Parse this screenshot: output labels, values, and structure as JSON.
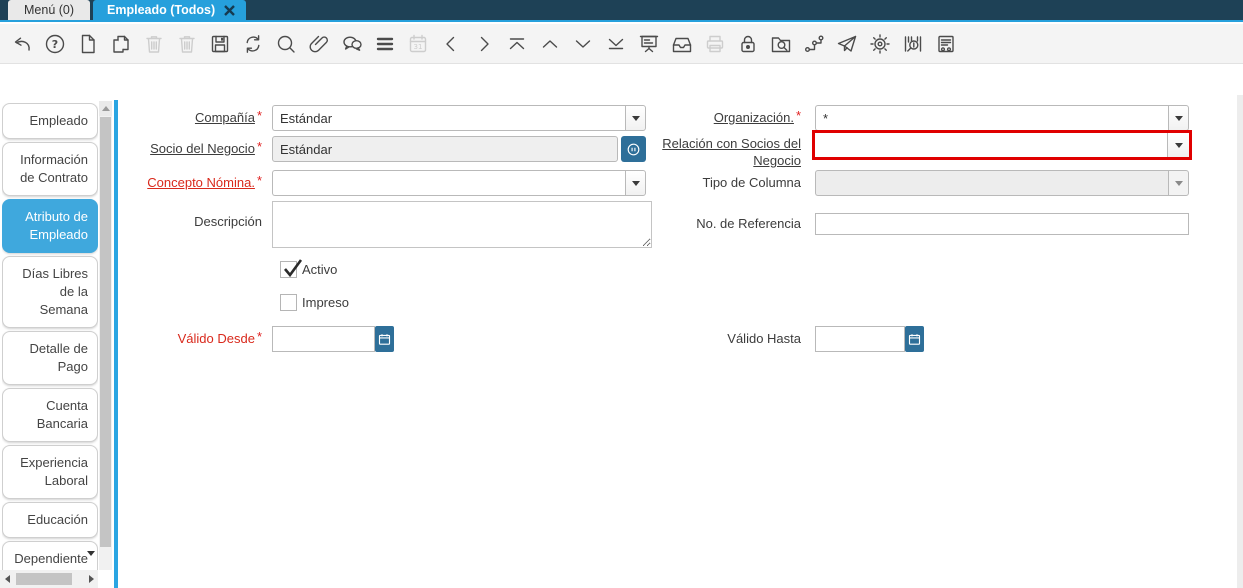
{
  "tabbar": {
    "tabs": [
      {
        "id": "menu",
        "label": "Menú (0)",
        "selected": false,
        "closable": false
      },
      {
        "id": "empleado-todos",
        "label": "Empleado (Todos)",
        "selected": true,
        "closable": true
      }
    ]
  },
  "toolbar": {
    "items": [
      {
        "name": "undo",
        "enabled": true
      },
      {
        "name": "help",
        "enabled": true
      },
      {
        "name": "new-record",
        "enabled": true
      },
      {
        "name": "copy-record",
        "enabled": true
      },
      {
        "name": "delete-record",
        "enabled": false
      },
      {
        "name": "delete-selection",
        "enabled": false
      },
      {
        "name": "save",
        "enabled": true
      },
      {
        "name": "refresh",
        "enabled": true
      },
      {
        "name": "find",
        "enabled": true
      },
      {
        "name": "attachment",
        "enabled": true
      },
      {
        "name": "chat",
        "enabled": true
      },
      {
        "name": "grid-toggle",
        "enabled": true
      },
      {
        "name": "calendar",
        "enabled": false
      },
      {
        "name": "parent-record",
        "enabled": true
      },
      {
        "name": "detail-record",
        "enabled": true
      },
      {
        "name": "first-record",
        "enabled": true
      },
      {
        "name": "previous-record",
        "enabled": true
      },
      {
        "name": "next-record",
        "enabled": true
      },
      {
        "name": "last-record",
        "enabled": true
      },
      {
        "name": "report",
        "enabled": true
      },
      {
        "name": "archive",
        "enabled": true
      },
      {
        "name": "print",
        "enabled": false
      },
      {
        "name": "lock",
        "enabled": true
      },
      {
        "name": "record-info",
        "enabled": true
      },
      {
        "name": "workflow",
        "enabled": true
      },
      {
        "name": "requests",
        "enabled": true
      },
      {
        "name": "process",
        "enabled": true
      },
      {
        "name": "product-info",
        "enabled": true
      },
      {
        "name": "quick-form",
        "enabled": true
      }
    ]
  },
  "sidebar": {
    "tabs": [
      {
        "id": "empleado",
        "label": "Empleado",
        "selected": false
      },
      {
        "id": "informacion-de-contrato",
        "label": "Información de Contrato",
        "selected": false
      },
      {
        "id": "atributo-de-empleado",
        "label": "Atributo de Empleado",
        "selected": true
      },
      {
        "id": "dias-libres-de-la-semana",
        "label": "Días Libres de la Semana",
        "selected": false
      },
      {
        "id": "detalle-de-pago",
        "label": "Detalle de Pago",
        "selected": false
      },
      {
        "id": "cuenta-bancaria",
        "label": "Cuenta Bancaria",
        "selected": false
      },
      {
        "id": "experiencia-laboral",
        "label": "Experiencia Laboral",
        "selected": false
      },
      {
        "id": "educacion",
        "label": "Educación",
        "selected": false
      },
      {
        "id": "dependiente",
        "label": "Dependiente",
        "selected": false,
        "overflow": true
      }
    ]
  },
  "required_marker": "*",
  "form": {
    "compania": {
      "label": "Compañía",
      "required": true,
      "value": "Estándar"
    },
    "organizacion": {
      "label": "Organización.",
      "required": true,
      "value": "*"
    },
    "socio_negocio": {
      "label": "Socio del Negocio",
      "required": true,
      "value": "Estándar"
    },
    "relacion_socios": {
      "label": "Relación con Socios del Negocio",
      "required": false,
      "value": ""
    },
    "concepto_nomina": {
      "label": "Concepto Nómina.",
      "required": true,
      "value": ""
    },
    "tipo_columna": {
      "label": "Tipo de Columna",
      "required": false,
      "value": "",
      "disabled": true
    },
    "descripcion": {
      "label": "Descripción",
      "value": ""
    },
    "no_referencia": {
      "label": "No. de Referencia",
      "value": ""
    },
    "activo": {
      "label": "Activo",
      "checked": true
    },
    "impreso": {
      "label": "Impreso",
      "checked": false
    },
    "valido_desde": {
      "label": "Válido Desde",
      "required": true,
      "value": ""
    },
    "valido_hasta": {
      "label": "Válido Hasta",
      "required": false,
      "value": ""
    }
  },
  "colors": {
    "header_bg": "#1e4156",
    "accent_blue": "#26a0dc",
    "sidebar_selected": "#3fa8dd",
    "button_blue": "#2e6f99",
    "error_border": "#e00000",
    "mandatory_label": "#d9291c"
  }
}
